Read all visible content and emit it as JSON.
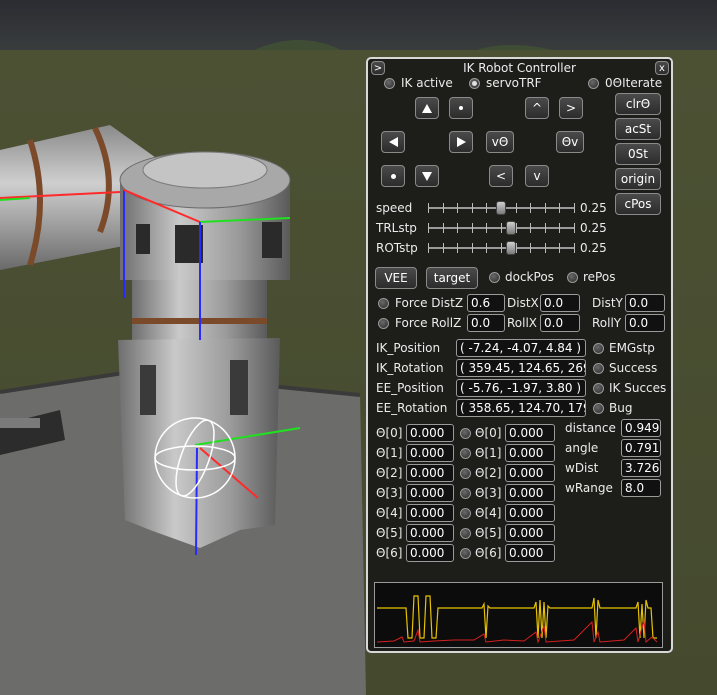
{
  "window": {
    "title": "IK Robot Controller",
    "collapse_label": ">",
    "close_label": "x"
  },
  "toggles_top": [
    {
      "label": "IK active",
      "on": false
    },
    {
      "label": "servoTRF",
      "on": true
    },
    {
      "label": "0ΘIterate",
      "on": false
    }
  ],
  "side_buttons": [
    "clrΘ",
    "acSt",
    "0St",
    "origin",
    "cPos"
  ],
  "nav": {
    "v_theta": "vΘ",
    "theta_v": "Θv",
    "caret_up": "^",
    "gt": ">",
    "lt": "<",
    "caret_down": "v"
  },
  "sliders": [
    {
      "label": "speed",
      "value_text": "0.25",
      "level": 0.5
    },
    {
      "label": "TRLstp",
      "value_text": "0.25",
      "level": 0.57
    },
    {
      "label": "ROTstp",
      "value_text": "0.25",
      "level": 0.57
    }
  ],
  "row_buttons": {
    "vee": "VEE",
    "target": "target",
    "dockpos": "dockPos",
    "repos": "rePos"
  },
  "force_distz": {
    "label": "Force DistZ",
    "value": "0.6",
    "distx_label": "DistX",
    "distx": "0.0",
    "disty_label": "DistY",
    "disty": "0.0"
  },
  "force_rollz": {
    "label": "Force RollZ",
    "value": "0.0",
    "rollx_label": "RollX",
    "rollx": "0.0",
    "rolly_label": "RollY",
    "rolly": "0.0"
  },
  "info_rows": [
    {
      "label": "IK_Position",
      "value": "( -7.24, -4.07, 4.84 )",
      "status": "EMGstp"
    },
    {
      "label": "IK_Rotation",
      "value": "( 359.45, 124.65, 269.",
      "status": "Success"
    },
    {
      "label": "EE_Position",
      "value": "( -5.76, -1.97, 3.80 )",
      "status": "IK Succes"
    },
    {
      "label": "EE_Rotation",
      "value": "( 358.65, 124.70, 179.",
      "status": "Bug"
    }
  ],
  "thetas": [
    {
      "label": "Θ[0]",
      "a": "0.000",
      "b": "0.000"
    },
    {
      "label": "Θ[1]",
      "a": "0.000",
      "b": "0.000"
    },
    {
      "label": "Θ[2]",
      "a": "0.000",
      "b": "0.000"
    },
    {
      "label": "Θ[3]",
      "a": "0.000",
      "b": "0.000"
    },
    {
      "label": "Θ[4]",
      "a": "0.000",
      "b": "0.000"
    },
    {
      "label": "Θ[5]",
      "a": "0.000",
      "b": "0.000"
    },
    {
      "label": "Θ[6]",
      "a": "0.000",
      "b": "0.000"
    }
  ],
  "metrics": [
    {
      "label": "distance",
      "value": "0.949"
    },
    {
      "label": "angle",
      "value": "0.791"
    },
    {
      "label": "wDist",
      "value": "3.726"
    },
    {
      "label": "wRange",
      "value": "8.0"
    }
  ],
  "colors": {
    "sky": "#2e3035",
    "ground": "#4f5436",
    "panel_bg": "#161616",
    "graph_yellow": "#e6c200",
    "graph_red": "#d42020",
    "axis_red": "#ff2a2a",
    "axis_green": "#20e020",
    "axis_blue": "#2a2aff"
  }
}
